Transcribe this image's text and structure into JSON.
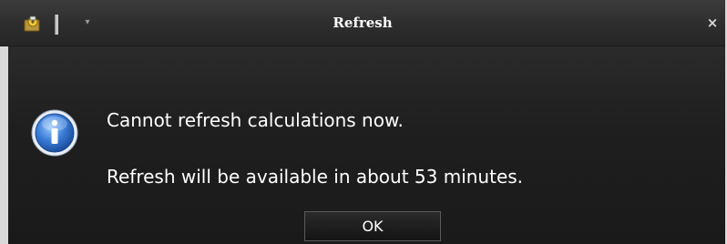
{
  "window": {
    "title": "Refresh",
    "close_symbol": "×",
    "icons": {
      "app": "app-icon",
      "qa_dropdown": "dropdown-arrow-icon",
      "info": "information-icon"
    }
  },
  "dialog": {
    "line1": "Cannot refresh calculations now.",
    "line2": "Refresh will be available in about 53 minutes.",
    "ok_label": "OK"
  },
  "colors": {
    "titlebar": "#2e2e2e",
    "content_bg": "#1f1f1f",
    "text": "#ffffff",
    "info_icon": "#3a7dd8"
  }
}
